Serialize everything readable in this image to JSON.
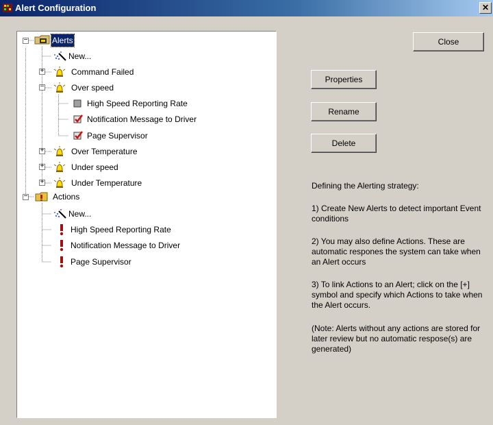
{
  "window": {
    "title": "Alert Configuration",
    "close_glyph": "✕"
  },
  "tree": {
    "alerts_root": "Alerts",
    "alerts": {
      "new": "New...",
      "command_failed": "Command Failed",
      "over_speed": "Over speed",
      "over_speed_children": [
        "High Speed Reporting Rate",
        "Notification Message to Driver",
        "Page Supervisor"
      ],
      "over_temperature": "Over Temperature",
      "under_speed": "Under speed",
      "under_temperature": "Under Temperature"
    },
    "actions_root": "Actions",
    "actions": {
      "new": "New...",
      "items": [
        "High Speed Reporting Rate",
        "Notification Message to Driver",
        "Page Supervisor"
      ]
    },
    "expander_plus": "+",
    "expander_minus": "−",
    "over_speed_checked": [
      false,
      true,
      true
    ]
  },
  "buttons": {
    "close": "Close",
    "properties": "Properties",
    "rename": "Rename",
    "delete": "Delete"
  },
  "help": {
    "heading": "Defining the Alerting strategy:",
    "p1": "1) Create New Alerts to detect important Event conditions",
    "p2": "2) You may also define Actions. These are automatic respones the system can take when an Alert occurs",
    "p3": "3) To link Actions to an Alert; click on the [+] symbol and specify which Actions to take when the Alert occurs.",
    "p4": "(Note: Alerts without any actions are stored for later review but no automatic respose(s) are generated)"
  },
  "colors": {
    "title_bar": "#0a246a",
    "selection": "#0a246a",
    "dialog_bg": "#d4d0c8"
  }
}
